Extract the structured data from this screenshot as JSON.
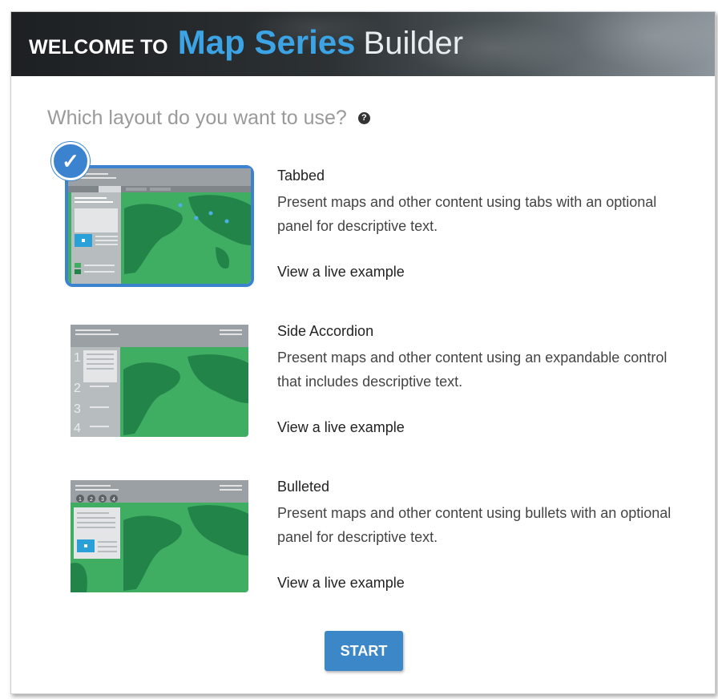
{
  "header": {
    "welcome_label": "WELCOME TO",
    "brand_label": "Map Series",
    "builder_label": "Builder"
  },
  "question": {
    "text": "Which layout do you want to use?",
    "help_icon": "help-circle-icon"
  },
  "layouts": [
    {
      "title": "Tabbed",
      "description": "Present maps and other content using tabs with an optional panel for descriptive text.",
      "link": "View a live example",
      "selected": true
    },
    {
      "title": "Side Accordion",
      "description": "Present maps and other content using an expandable control that includes descriptive text.",
      "link": "View a live example",
      "selected": false
    },
    {
      "title": "Bulleted",
      "description": "Present maps and other content using bullets with an optional panel for descriptive text.",
      "link": "View a live example",
      "selected": false
    }
  ],
  "accordion_numbers": [
    "1",
    "2",
    "3",
    "4"
  ],
  "bullet_numbers": [
    "1",
    "2",
    "3",
    "4"
  ],
  "start_label": "START",
  "colors": {
    "accent": "#3b83cf",
    "brand_blue": "#3ca4e4",
    "map_green": "#3fae63",
    "map_dark_green": "#23844a"
  }
}
